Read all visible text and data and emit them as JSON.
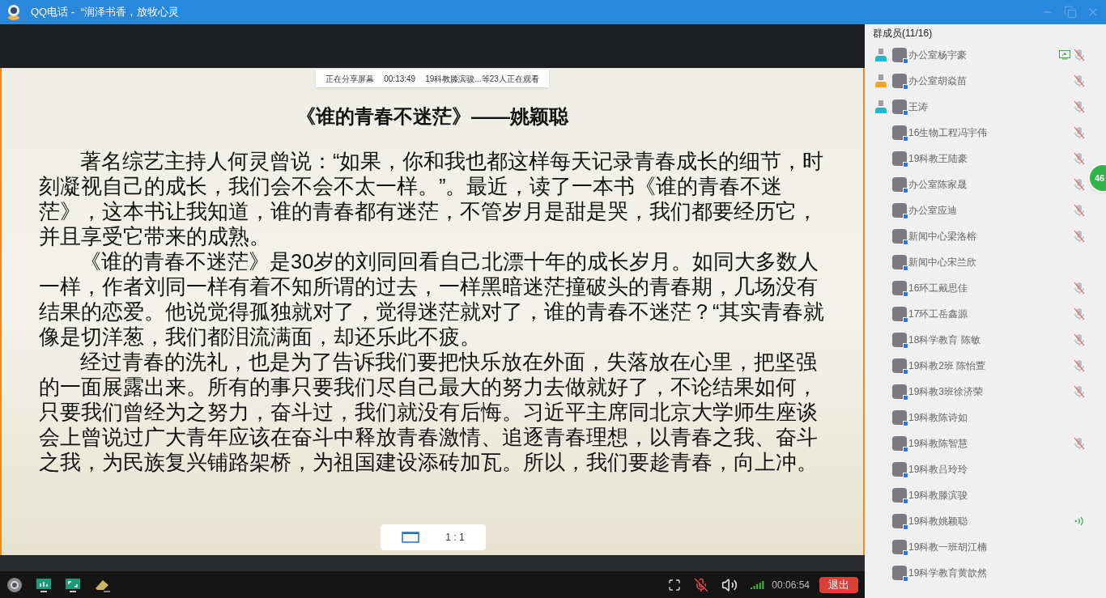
{
  "window": {
    "title": "QQ电话 -  “润泽书香，放牧心灵"
  },
  "share_bar": {
    "status": "正在分享屏幕",
    "elapsed": "00:13:49",
    "viewers": "19科教滕滨骏...等23人正在观看"
  },
  "document": {
    "title": "《谁的青春不迷茫》——姚颖聪",
    "paragraphs": [
      "著名综艺主持人何灵曾说：“如果，你和我也都这样每天记录青春成长的细节，时刻凝视自己的成长，我们会不会不太一样。”。最近，读了一本书《谁的青春不迷茫》，这本书让我知道，谁的青春都有迷茫，不管岁月是甜是哭，我们都要经历它，并且享受它带来的成熟。",
      "《谁的青春不迷茫》是30岁的刘同回看自己北漂十年的成长岁月。如同大多数人一样，作者刘同一样有着不知所谓的过去，一样黑暗迷茫撞破头的青春期，几场没有结果的恋爱。他说觉得孤独就对了，觉得迷茫就对了，谁的青春不迷茫？“其实青春就像是切洋葱，我们都泪流满面，却还乐此不疲。",
      "经过青春的洗礼，也是为了告诉我们要把快乐放在外面，失落放在心里，把坚强的一面展露出来。所有的事只要我们尽自己最大的努力去做就好了，不论结果如何，只要我们曾经为之努力，奋斗过，我们就没有后悔。习近平主席同北京大学师生座谈会上曾说过广大青年应该在奋斗中释放青春激情、追逐青春理想，以青春之我、奋斗之我，为民族复兴铺路架桥，为祖国建设添砖加瓦。所以，我们要趁青春，向上冲。"
    ]
  },
  "ratio_button": {
    "label": "1 : 1"
  },
  "toolbar": {
    "mic_muted": true,
    "call_time": "00:06:54",
    "exit_button": "退出"
  },
  "members": {
    "header": "群成员(11/16)",
    "float_badge": "46",
    "items": [
      {
        "name": "办公室杨宇豪",
        "admin": true,
        "owner": false,
        "sharing": true,
        "muted": true,
        "speaking": false
      },
      {
        "name": "办公室胡焱苗",
        "admin": false,
        "owner": true,
        "sharing": false,
        "muted": true,
        "speaking": false
      },
      {
        "name": "王涛",
        "admin": true,
        "owner": false,
        "sharing": false,
        "muted": true,
        "speaking": false
      },
      {
        "name": "16生物工程冯宇伟",
        "admin": false,
        "owner": false,
        "sharing": false,
        "muted": true,
        "speaking": false
      },
      {
        "name": "19科教王陆豪",
        "admin": false,
        "owner": false,
        "sharing": false,
        "muted": true,
        "speaking": false
      },
      {
        "name": "办公室陈家晟",
        "admin": false,
        "owner": false,
        "sharing": false,
        "muted": true,
        "speaking": false
      },
      {
        "name": "办公室应迪",
        "admin": false,
        "owner": false,
        "sharing": false,
        "muted": true,
        "speaking": false
      },
      {
        "name": "新闻中心梁洛榕",
        "admin": false,
        "owner": false,
        "sharing": false,
        "muted": true,
        "speaking": false
      },
      {
        "name": "新闻中心宋兰欣",
        "admin": false,
        "owner": false,
        "sharing": false,
        "muted": false,
        "speaking": false
      },
      {
        "name": "16环工戴思佳",
        "admin": false,
        "owner": false,
        "sharing": false,
        "muted": true,
        "speaking": false
      },
      {
        "name": "17环工岳鑫源",
        "admin": false,
        "owner": false,
        "sharing": false,
        "muted": true,
        "speaking": false
      },
      {
        "name": "18科学教育 陈敏",
        "admin": false,
        "owner": false,
        "sharing": false,
        "muted": true,
        "speaking": false
      },
      {
        "name": "19科教2班 陈怡萱",
        "admin": false,
        "owner": false,
        "sharing": false,
        "muted": true,
        "speaking": false
      },
      {
        "name": "19科教3班徐济荣",
        "admin": false,
        "owner": false,
        "sharing": false,
        "muted": true,
        "speaking": false
      },
      {
        "name": "19科教陈诗如",
        "admin": false,
        "owner": false,
        "sharing": false,
        "muted": false,
        "speaking": false
      },
      {
        "name": "19科教陈智慧",
        "admin": false,
        "owner": false,
        "sharing": false,
        "muted": true,
        "speaking": false
      },
      {
        "name": "19科教吕玲玲",
        "admin": false,
        "owner": false,
        "sharing": false,
        "muted": false,
        "speaking": false
      },
      {
        "name": "19科教滕滨骏",
        "admin": false,
        "owner": false,
        "sharing": false,
        "muted": false,
        "speaking": false
      },
      {
        "name": "19科教姚颖聪",
        "admin": false,
        "owner": false,
        "sharing": false,
        "muted": false,
        "speaking": true
      },
      {
        "name": "19科教一班胡江楠",
        "admin": false,
        "owner": false,
        "sharing": false,
        "muted": false,
        "speaking": false
      },
      {
        "name": "19科学教育黄歆然",
        "admin": false,
        "owner": false,
        "sharing": false,
        "muted": false,
        "speaking": false
      }
    ]
  }
}
